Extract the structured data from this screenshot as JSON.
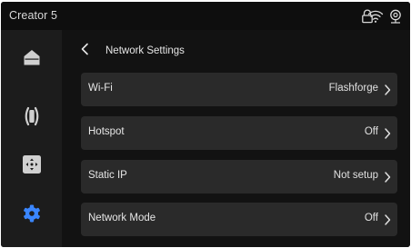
{
  "topbar": {
    "title": "Creator 5",
    "icons": [
      "lock-icon",
      "wifi-icon",
      "camera-icon"
    ]
  },
  "sidebar": {
    "items": [
      {
        "name": "home",
        "icon": "home-icon",
        "active": false
      },
      {
        "name": "filament",
        "icon": "filament-spool-icon",
        "active": false
      },
      {
        "name": "move",
        "icon": "move-control-icon",
        "active": false
      },
      {
        "name": "settings",
        "icon": "gear-icon",
        "active": true
      }
    ],
    "active_color": "#3a86ff",
    "icon_color": "#d0d0d0"
  },
  "main": {
    "back_icon": "chevron-left-icon",
    "title": "Network Settings",
    "rows": [
      {
        "label": "Wi-Fi",
        "value": "Flashforge"
      },
      {
        "label": "Hotspot",
        "value": "Off"
      },
      {
        "label": "Static IP",
        "value": "Not setup"
      },
      {
        "label": "Network Mode",
        "value": "Off"
      }
    ]
  }
}
